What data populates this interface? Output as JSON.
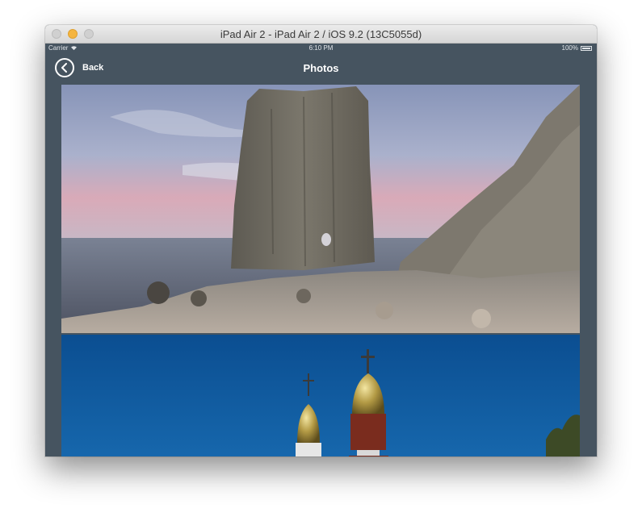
{
  "window": {
    "title": "iPad Air 2 - iPad Air 2 / iOS 9.2 (13C5055d)"
  },
  "status_bar": {
    "carrier": "Carrier",
    "time": "6:10 PM",
    "battery": "100%"
  },
  "nav": {
    "back_label": "Back",
    "title": "Photos"
  },
  "photos": [
    {
      "subject": "sea cliff rock on coast"
    },
    {
      "subject": "church domes with crosses at dusk"
    }
  ],
  "colors": {
    "chrome": "#465460",
    "accent": "#ffffff"
  },
  "icons": {
    "back": "chevron-left-circle-icon",
    "wifi": "wifi-icon",
    "battery": "battery-icon"
  }
}
